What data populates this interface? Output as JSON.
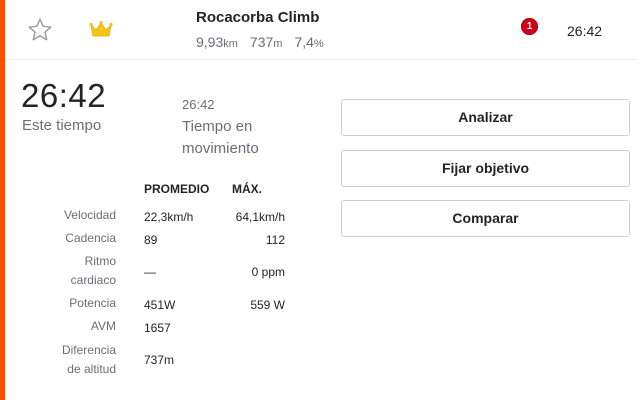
{
  "segment": {
    "name": "Rocacorba Climb",
    "distance_value": "9,93",
    "distance_unit": "km",
    "elevation_value": "737",
    "elevation_unit": "m",
    "grade": "7,4",
    "grade_unit": "%",
    "badge_count": "1",
    "time": "26:42",
    "icons": {
      "star": "star-icon",
      "crown": "crown-icon"
    }
  },
  "summary": {
    "elapsed_time": "26:42",
    "elapsed_label": "Este tiempo",
    "moving_time": "26:42",
    "moving_label": "Tiempo en movimiento"
  },
  "stats": {
    "headers": {
      "avg": "PROMEDIO",
      "max": "MÁX."
    },
    "rows": [
      {
        "label": "Velocidad",
        "avg": "22,3km/h",
        "max": "64,1km/h"
      },
      {
        "label": "Cadencia",
        "avg": "89",
        "max": "112"
      },
      {
        "label": "Ritmo cardiaco",
        "avg": "—",
        "max": "0 ppm"
      },
      {
        "label": "Potencia",
        "avg": "451W",
        "max": "559 W"
      },
      {
        "label": "AVM",
        "avg": "1657",
        "max": ""
      },
      {
        "label": "Diferencia de altitud",
        "avg": "737m",
        "max": ""
      }
    ]
  },
  "actions": {
    "analyze": "Analizar",
    "set_goal": "Fijar objetivo",
    "compare": "Comparar"
  },
  "colors": {
    "accent": "#fc5200",
    "crown": "#f5c518",
    "badge": "#d0021b",
    "muted_text": "#6d6d78",
    "text": "#242428"
  }
}
